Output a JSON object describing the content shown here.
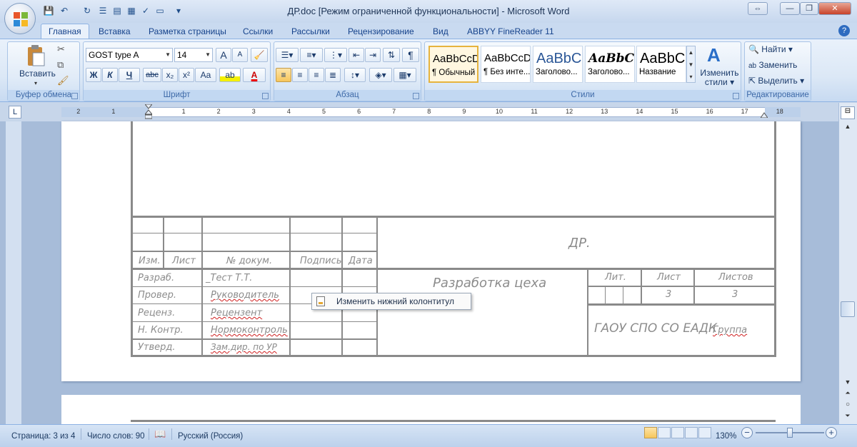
{
  "window": {
    "title": "ДР.doc [Режим ограниченной функциональности] - Microsoft Word",
    "min_label": "—",
    "max_label": "❐",
    "close_label": "✕"
  },
  "tabs": [
    "Главная",
    "Вставка",
    "Разметка страницы",
    "Ссылки",
    "Рассылки",
    "Рецензирование",
    "Вид",
    "ABBYY FineReader 11"
  ],
  "clipboard": {
    "paste_label": "Вставить",
    "group_label": "Буфер обмена"
  },
  "font": {
    "family": "GOST type A",
    "size": "14",
    "bold": "Ж",
    "italic": "К",
    "underline": "Ч",
    "strike": "abc",
    "subscript": "x₂",
    "superscript": "x²",
    "case": "Aa",
    "grow": "A",
    "shrink": "A",
    "color_a": "A",
    "group_label": "Шрифт"
  },
  "paragraph": {
    "pilcrow": "¶",
    "group_label": "Абзац"
  },
  "styles": {
    "items": [
      {
        "sample": "AaBbCcDd",
        "name": "¶ Обычный"
      },
      {
        "sample": "AaBbCcDd",
        "name": "¶ Без инте..."
      },
      {
        "sample": "AaBbC",
        "name": "Заголово..."
      },
      {
        "sample": "AaBbCc",
        "name": "Заголово..."
      },
      {
        "sample": "AaBbC",
        "name": "Название"
      }
    ],
    "change_label_1": "Изменить",
    "change_label_2": "стили",
    "group_label": "Стили"
  },
  "editing": {
    "find": "Найти",
    "replace": "Заменить",
    "select": "Выделить",
    "group_label": "Редактирование"
  },
  "ruler": {
    "numbers": [
      "2",
      "1",
      "1",
      "2",
      "3",
      "4",
      "5",
      "6",
      "7",
      "8",
      "9",
      "10",
      "11",
      "12",
      "13",
      "14",
      "15",
      "16",
      "17",
      "18"
    ]
  },
  "stamp": {
    "doc_code": "ДР.",
    "header_izm": "Изм.",
    "header_list": "Лист",
    "header_docnum": "№ докум.",
    "header_sign": "Подпись",
    "header_date": "Дата",
    "rows": [
      {
        "role": "Разраб.",
        "name": "_Тест Т.Т."
      },
      {
        "role": "Провер.",
        "name": "Руководитель"
      },
      {
        "role": "Реценз.",
        "name": "Рецензент"
      },
      {
        "role": "Н. Контр.",
        "name": "Нормоконтроль"
      },
      {
        "role": "Утверд.",
        "name": "Зам.дир. по УР"
      }
    ],
    "title": "Разработка цеха",
    "lit": "Лит.",
    "sheet": "Лист",
    "sheets": "Листов",
    "sheet_val": "3",
    "sheets_val": "3",
    "org": "ГАОУ СПО СО ЕАДК",
    "group": "Группа"
  },
  "popup": {
    "label": "Изменить нижний колонтитул"
  },
  "status": {
    "page": "Страница: 3 из 4",
    "words": "Число слов: 90",
    "lang": "Русский (Россия)",
    "zoom": "130%"
  }
}
